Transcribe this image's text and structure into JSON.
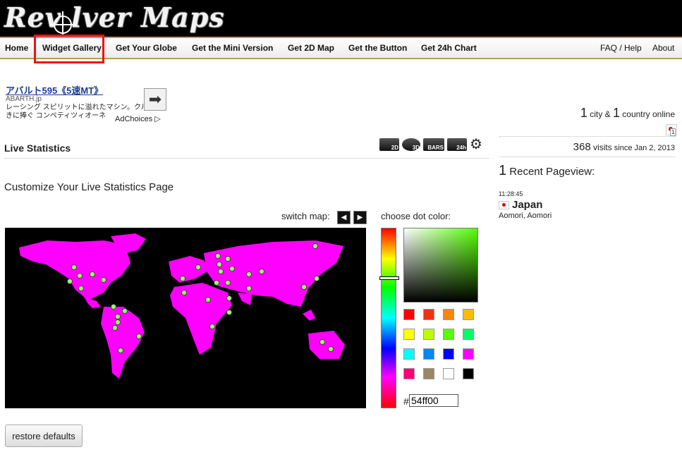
{
  "header": {
    "logo_text": "Rev lver Maps"
  },
  "nav": {
    "items": [
      "Home",
      "Widget Gallery",
      "Get Your Globe",
      "Get the Mini Version",
      "Get 2D Map",
      "Get the Button",
      "Get 24h Chart"
    ],
    "right_items": [
      "FAQ / Help",
      "About"
    ],
    "highlighted": "Widget Gallery"
  },
  "ad": {
    "title": "アバルト595《5速MT》",
    "domain": "ABARTH.jp",
    "text": "レーシング スピリットに溢れたマシン。クルマ好きに捧ぐ コンペティツィオーネ",
    "adchoices": "AdChoices ▷",
    "arrow_icon": "arrow-right-icon"
  },
  "stats": {
    "city_count": "1",
    "city_label": " city & ",
    "country_count": "1",
    "country_label": " country online",
    "flag_badge": "1",
    "visits_count": "368",
    "visits_label": " visits",
    "visits_since": " since Jan 2, 2013"
  },
  "live": {
    "title": "Live Statistics",
    "modes": [
      "2D",
      "3D",
      "BARS",
      "24h"
    ],
    "customize_title": "Customize Your Live Statistics Page",
    "switch_map_label": "switch map:",
    "prev_icon": "◀",
    "next_icon": "▶"
  },
  "colors": {
    "map_land": "#ff00ff",
    "map_ocean": "#000000",
    "dot_color": "#99ff66",
    "choose_label": "choose dot color:",
    "hash": "#",
    "hex_value": "54ff00",
    "swatches": [
      "#ff0000",
      "#ee3311",
      "#ff8800",
      "#ffbb00",
      "#ffff00",
      "#bbff00",
      "#55ff00",
      "#00ff66",
      "#00ffff",
      "#0088ee",
      "#0000ff",
      "#ff00ff",
      "#ff0077",
      "#998866",
      "#ffffff",
      "#000000"
    ]
  },
  "restore_label": "restore defaults",
  "recent": {
    "count": "1",
    "label": " Recent Pageview:",
    "time": "11:28:45",
    "country": "Japan",
    "location": "Aomori, Aomori"
  }
}
